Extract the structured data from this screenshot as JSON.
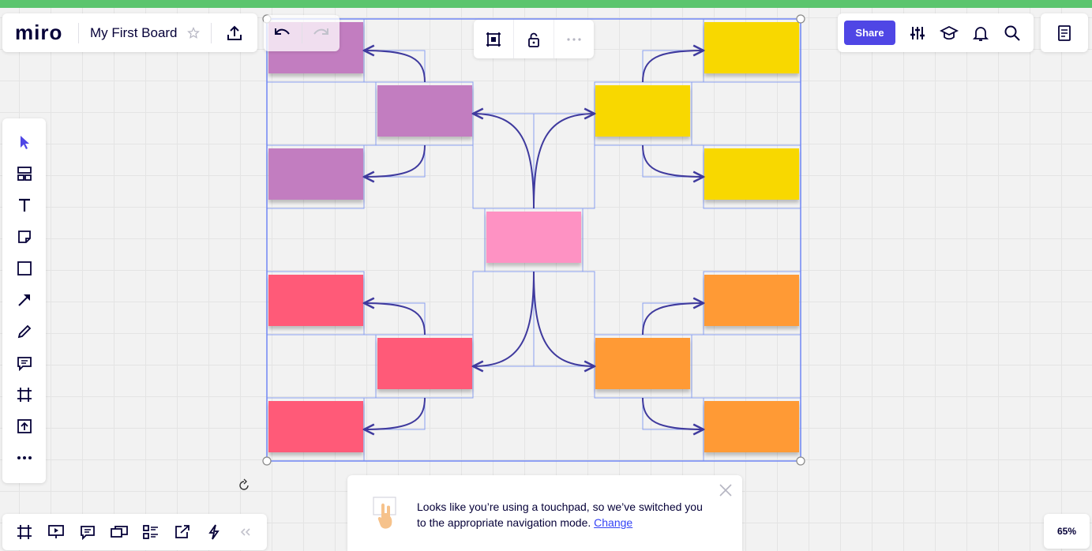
{
  "app": {
    "logo": "miro",
    "board_title": "My First Board"
  },
  "header": {
    "share_label": "Share"
  },
  "icons": {
    "star": "star-outline-icon",
    "export": "upload-icon",
    "undo": "undo-icon",
    "redo": "redo-icon",
    "frame_select": "frame-icon",
    "lock": "lock-icon",
    "more": "more-horizontal-icon",
    "settings": "sliders-icon",
    "learn": "graduation-cap-icon",
    "notifications": "bell-icon",
    "search": "search-icon",
    "notes": "notes-icon"
  },
  "left_toolbar": [
    "select",
    "templates",
    "text",
    "sticky-note",
    "shape",
    "arrow",
    "pen",
    "comment",
    "frame",
    "upload",
    "more"
  ],
  "bottom_toolbar": [
    "frames",
    "presentation",
    "comments",
    "screen-share",
    "cards",
    "export",
    "lightning",
    "collapse"
  ],
  "zoom": "65%",
  "toast": {
    "message": "Looks like you’re using a touchpad, so we’ve switched you to the appropriate navigation mode.",
    "link": "Change"
  },
  "colors": {
    "accent": "#4f46e5",
    "purple_note": "#c27dc0",
    "yellow_note": "#f8d800",
    "pink_note": "#fe92c3",
    "red_note": "#ff5a78",
    "orange_note": "#ff9a35",
    "connector": "#3f3a9e",
    "selection": "#6f86f5"
  },
  "mindmap": {
    "center": {
      "color": "pink"
    },
    "branches": [
      {
        "color": "purple",
        "count": 3
      },
      {
        "color": "yellow",
        "count": 3
      },
      {
        "color": "red",
        "count": 3
      },
      {
        "color": "orange",
        "count": 3
      }
    ]
  }
}
